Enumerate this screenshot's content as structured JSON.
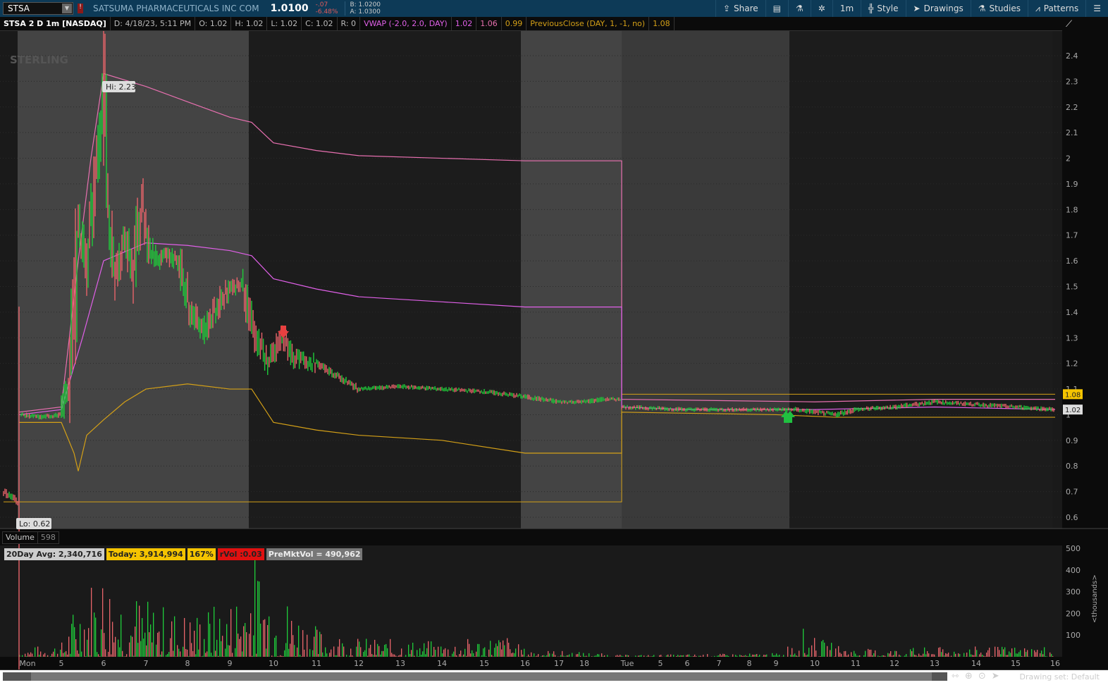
{
  "header": {
    "symbol": "STSA",
    "company": "SATSUMA PHARMACEUTICALS INC COM",
    "last": "1.0100",
    "change": "-.07",
    "change_pct": "-6.48%",
    "bid": "B: 1.0200",
    "ask": "A: 1.0300"
  },
  "toolbar": {
    "share": "Share",
    "interval": "1m",
    "style": "Style",
    "drawings": "Drawings",
    "studies": "Studies",
    "patterns": "Patterns"
  },
  "info": {
    "title": "STSA 2 D 1m [NASDAQ]",
    "date": "D: 4/18/23, 5:11 PM",
    "open": "O: 1.02",
    "high": "H: 1.02",
    "low": "L: 1.02",
    "close": "C: 1.02",
    "range": "R: 0",
    "vwap_label": "VWAP (-2.0, 2.0, DAY)",
    "vwap": "1.02",
    "vwap_upper": "1.06",
    "vwap_lower": "0.99",
    "prev_close_label": "PreviousClose (DAY, 1, -1, no)",
    "prev_close": "1.08"
  },
  "watermark": "STERLING",
  "markers": {
    "hi": "Hi: 2.23",
    "lo": "Lo: 0.62",
    "price_tag_prev": "1.08",
    "price_tag_last": "1.02"
  },
  "volume": {
    "label": "Volume",
    "value": "598",
    "avg20": "20Day Avg: 2,340,716",
    "today": "Today: 3,914,994",
    "pct": "167%",
    "rvol": "rVol :0.03",
    "premkt": "PreMktVol = 490,962",
    "unit": "<thousands>"
  },
  "footer": {
    "drawing_set": "Drawing set: Default"
  },
  "colors": {
    "up": "#1fcc3a",
    "down": "#e8646a",
    "vwap": "#e060e8",
    "upper": "#e870b0",
    "lower": "#d4a017",
    "prev": "#d4a017"
  },
  "chart_data": {
    "type": "line",
    "price_axis": {
      "ticks": [
        "0.6",
        "0.7",
        "0.8",
        "0.9",
        "1",
        "1.1",
        "1.2",
        "1.3",
        "1.4",
        "1.5",
        "1.6",
        "1.7",
        "1.8",
        "1.9",
        "2",
        "2.1",
        "2.2",
        "2.3",
        "2.4"
      ]
    },
    "volume_axis": {
      "ticks": [
        "100",
        "200",
        "300",
        "400",
        "500"
      ]
    },
    "time_labels": [
      [
        "Mon",
        4
      ],
      [
        "5",
        5
      ],
      [
        "6",
        6
      ],
      [
        "7",
        7
      ],
      [
        "8",
        8
      ],
      [
        "9",
        9
      ],
      [
        "10",
        10
      ],
      [
        "11",
        11
      ],
      [
        "12",
        12
      ],
      [
        "13",
        13
      ],
      [
        "14",
        14
      ],
      [
        "15",
        15
      ],
      [
        "16",
        16
      ],
      [
        "17",
        17
      ],
      [
        "18",
        18
      ],
      [
        "Tue",
        28
      ],
      [
        "5",
        29
      ],
      [
        "6",
        30
      ],
      [
        "7",
        31
      ],
      [
        "8",
        32
      ],
      [
        "9",
        33
      ],
      [
        "10",
        34
      ],
      [
        "11",
        35
      ],
      [
        "12",
        36
      ],
      [
        "13",
        37
      ],
      [
        "14",
        38
      ],
      [
        "15",
        39
      ],
      [
        "16",
        40
      ]
    ],
    "price": [
      [
        3.9,
        0.7
      ],
      [
        4.0,
        0.66
      ],
      [
        4.05,
        1.0
      ],
      [
        4.5,
        0.99
      ],
      [
        5,
        1.0
      ],
      [
        5.2,
        1.15
      ],
      [
        5.3,
        1.4
      ],
      [
        5.4,
        1.75
      ],
      [
        5.6,
        1.6
      ],
      [
        5.8,
        1.9
      ],
      [
        6.0,
        2.23
      ],
      [
        6.1,
        1.8
      ],
      [
        6.3,
        1.55
      ],
      [
        6.5,
        1.7
      ],
      [
        6.7,
        1.55
      ],
      [
        6.9,
        1.85
      ],
      [
        7.1,
        1.65
      ],
      [
        7.3,
        1.6
      ],
      [
        7.5,
        1.62
      ],
      [
        7.8,
        1.6
      ],
      [
        8.1,
        1.4
      ],
      [
        8.4,
        1.33
      ],
      [
        8.8,
        1.45
      ],
      [
        9.0,
        1.5
      ],
      [
        9.3,
        1.5
      ],
      [
        9.6,
        1.3
      ],
      [
        9.9,
        1.2
      ],
      [
        10.2,
        1.3
      ],
      [
        10.5,
        1.22
      ],
      [
        11,
        1.2
      ],
      [
        11.5,
        1.15
      ],
      [
        12,
        1.1
      ],
      [
        13,
        1.11
      ],
      [
        14,
        1.1
      ],
      [
        15,
        1.09
      ],
      [
        16,
        1.07
      ],
      [
        17,
        1.05
      ],
      [
        18,
        1.05
      ],
      [
        19,
        1.06
      ],
      [
        20,
        1.06
      ],
      [
        28,
        1.03
      ],
      [
        30,
        1.02
      ],
      [
        32,
        1.02
      ],
      [
        33.5,
        1.02
      ],
      [
        34.5,
        1.0
      ],
      [
        35,
        1.02
      ],
      [
        36,
        1.03
      ],
      [
        37,
        1.05
      ],
      [
        38,
        1.04
      ],
      [
        39,
        1.03
      ],
      [
        40,
        1.02
      ]
    ],
    "vwap": [
      [
        4,
        1.0
      ],
      [
        5,
        1.02
      ],
      [
        5.5,
        1.3
      ],
      [
        6,
        1.6
      ],
      [
        7,
        1.67
      ],
      [
        8,
        1.66
      ],
      [
        9,
        1.64
      ],
      [
        9.5,
        1.62
      ],
      [
        10,
        1.53
      ],
      [
        11,
        1.49
      ],
      [
        12,
        1.46
      ],
      [
        14,
        1.44
      ],
      [
        16,
        1.42
      ],
      [
        20,
        1.42
      ],
      [
        20.001,
        1.03
      ],
      [
        30,
        1.02
      ],
      [
        34,
        1.02
      ],
      [
        37,
        1.03
      ],
      [
        40,
        1.02
      ]
    ],
    "vwap_upper": [
      [
        4,
        1.01
      ],
      [
        5,
        1.03
      ],
      [
        5.4,
        1.6
      ],
      [
        5.7,
        2.0
      ],
      [
        6,
        2.33
      ],
      [
        7,
        2.28
      ],
      [
        8,
        2.22
      ],
      [
        9,
        2.16
      ],
      [
        9.5,
        2.14
      ],
      [
        10,
        2.06
      ],
      [
        11,
        2.03
      ],
      [
        12,
        2.01
      ],
      [
        14,
        2.0
      ],
      [
        16,
        1.99
      ],
      [
        20,
        1.99
      ],
      [
        20.001,
        1.06
      ],
      [
        34,
        1.05
      ],
      [
        37,
        1.06
      ],
      [
        40,
        1.06
      ]
    ],
    "vwap_lower": [
      [
        4,
        0.97
      ],
      [
        5,
        0.97
      ],
      [
        5.3,
        0.85
      ],
      [
        5.4,
        0.78
      ],
      [
        5.6,
        0.92
      ],
      [
        6,
        0.98
      ],
      [
        6.5,
        1.05
      ],
      [
        7,
        1.1
      ],
      [
        8,
        1.12
      ],
      [
        9,
        1.1
      ],
      [
        9.5,
        1.1
      ],
      [
        10,
        0.97
      ],
      [
        11,
        0.94
      ],
      [
        12,
        0.92
      ],
      [
        14,
        0.9
      ],
      [
        16,
        0.85
      ],
      [
        20,
        0.85
      ],
      [
        20.001,
        1.01
      ],
      [
        33,
        1.0
      ],
      [
        34.5,
        0.99
      ],
      [
        40,
        0.99
      ]
    ],
    "prev_close": [
      [
        3.9,
        0.66
      ],
      [
        20,
        0.66
      ],
      [
        20.001,
        1.08
      ],
      [
        40,
        1.08
      ]
    ],
    "volume_envelope": [
      [
        4,
        20
      ],
      [
        5,
        40
      ],
      [
        5.5,
        200
      ],
      [
        6,
        250
      ],
      [
        7,
        150
      ],
      [
        8,
        120
      ],
      [
        9,
        150
      ],
      [
        9.5,
        300
      ],
      [
        10,
        200
      ],
      [
        11,
        80
      ],
      [
        12,
        50
      ],
      [
        14,
        40
      ],
      [
        15.5,
        60
      ],
      [
        16,
        20
      ],
      [
        20,
        5
      ],
      [
        28,
        5
      ],
      [
        33.2,
        10
      ],
      [
        33.5,
        90
      ],
      [
        34,
        50
      ],
      [
        35,
        20
      ],
      [
        37,
        25
      ],
      [
        40,
        30
      ]
    ]
  }
}
